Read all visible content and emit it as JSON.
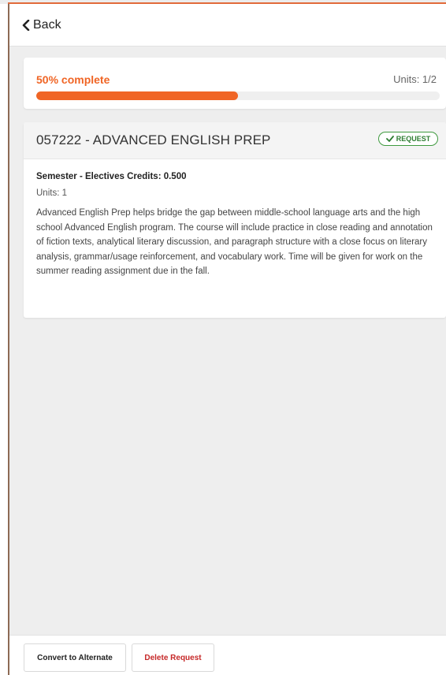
{
  "header": {
    "back_label": "Back"
  },
  "progress": {
    "label": "50% complete",
    "percent": 50,
    "units_label": "Units: 1/2"
  },
  "course": {
    "title": "057222 - ADVANCED ENGLISH PREP",
    "badge": "REQUEST",
    "credits_line": "Semester - Electives Credits: 0.500",
    "units_line": "Units: 1",
    "description": "Advanced English Prep helps bridge the gap between middle-school language arts and the high school Advanced English program. The course will include practice in close reading and annotation of fiction texts, analytical literary discussion, and paragraph structure with a close focus on literary analysis, grammar/usage reinforcement, and vocabulary work. Time will be given for work on the summer reading assignment due in the fall."
  },
  "footer": {
    "convert_label": "Convert to Alternate",
    "delete_label": "Delete Request"
  },
  "colors": {
    "accent": "#f06525",
    "success": "#2e7d32",
    "danger": "#c62828"
  },
  "icons": {
    "back": "chevron-left-icon",
    "badge": "check-icon"
  }
}
